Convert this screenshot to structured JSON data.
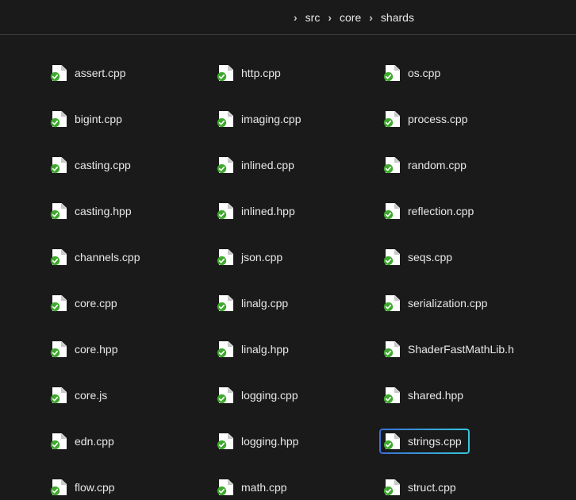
{
  "breadcrumb": {
    "sep": "›",
    "segments": [
      "src",
      "core",
      "shards"
    ]
  },
  "columns": [
    [
      {
        "name": "assert.cpp",
        "highlighted": false
      },
      {
        "name": "bigint.cpp",
        "highlighted": false
      },
      {
        "name": "casting.cpp",
        "highlighted": false
      },
      {
        "name": "casting.hpp",
        "highlighted": false
      },
      {
        "name": "channels.cpp",
        "highlighted": false
      },
      {
        "name": "core.cpp",
        "highlighted": false
      },
      {
        "name": "core.hpp",
        "highlighted": false
      },
      {
        "name": "core.js",
        "highlighted": false
      },
      {
        "name": "edn.cpp",
        "highlighted": false
      },
      {
        "name": "flow.cpp",
        "highlighted": false
      }
    ],
    [
      {
        "name": "http.cpp",
        "highlighted": false
      },
      {
        "name": "imaging.cpp",
        "highlighted": false
      },
      {
        "name": "inlined.cpp",
        "highlighted": false
      },
      {
        "name": "inlined.hpp",
        "highlighted": false
      },
      {
        "name": "json.cpp",
        "highlighted": false
      },
      {
        "name": "linalg.cpp",
        "highlighted": false
      },
      {
        "name": "linalg.hpp",
        "highlighted": false
      },
      {
        "name": "logging.cpp",
        "highlighted": false
      },
      {
        "name": "logging.hpp",
        "highlighted": false
      },
      {
        "name": "math.cpp",
        "highlighted": false
      }
    ],
    [
      {
        "name": "os.cpp",
        "highlighted": false
      },
      {
        "name": "process.cpp",
        "highlighted": false
      },
      {
        "name": "random.cpp",
        "highlighted": false
      },
      {
        "name": "reflection.cpp",
        "highlighted": false
      },
      {
        "name": "seqs.cpp",
        "highlighted": false
      },
      {
        "name": "serialization.cpp",
        "highlighted": false
      },
      {
        "name": "ShaderFastMathLib.h",
        "highlighted": false
      },
      {
        "name": "shared.hpp",
        "highlighted": false
      },
      {
        "name": "strings.cpp",
        "highlighted": true
      },
      {
        "name": "struct.cpp",
        "highlighted": false
      }
    ]
  ]
}
